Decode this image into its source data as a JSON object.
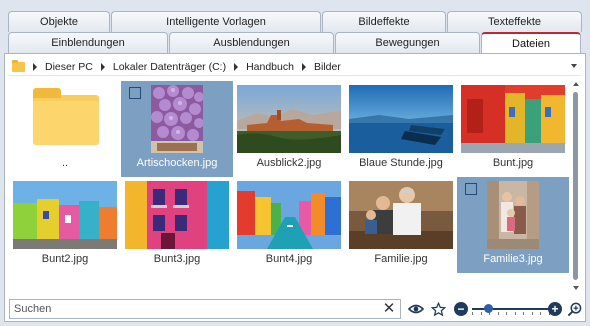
{
  "tabs_top": [
    {
      "label": "Objekte",
      "active": false
    },
    {
      "label": "Intelligente Vorlagen",
      "active": false
    },
    {
      "label": "Bildeffekte",
      "active": false
    },
    {
      "label": "Texteffekte",
      "active": false
    }
  ],
  "tabs_bottom": [
    {
      "label": "Einblendungen",
      "active": false
    },
    {
      "label": "Ausblendungen",
      "active": false
    },
    {
      "label": "Bewegungen",
      "active": false
    },
    {
      "label": "Dateien",
      "active": true
    }
  ],
  "breadcrumb": [
    "Dieser PC",
    "Lokaler Datenträger (C:)",
    "Handbuch",
    "Bilder"
  ],
  "files": [
    {
      "label": "..",
      "kind": "folder",
      "selected": false,
      "icon": "folder-icon"
    },
    {
      "label": "Artischocken.jpg",
      "kind": "image",
      "selected": true
    },
    {
      "label": "Ausblick2.jpg",
      "kind": "image",
      "selected": false
    },
    {
      "label": "Blaue Stunde.jpg",
      "kind": "image",
      "selected": false
    },
    {
      "label": "Bunt.jpg",
      "kind": "image",
      "selected": false
    },
    {
      "label": "Bunt2.jpg",
      "kind": "image",
      "selected": false
    },
    {
      "label": "Bunt3.jpg",
      "kind": "image",
      "selected": false
    },
    {
      "label": "Bunt4.jpg",
      "kind": "image",
      "selected": false
    },
    {
      "label": "Familie.jpg",
      "kind": "image",
      "selected": false
    },
    {
      "label": "Familie3.jpg",
      "kind": "image",
      "selected": true
    }
  ],
  "search": {
    "placeholder": "Suchen",
    "value": ""
  },
  "zoom": {
    "level": 0.2
  },
  "colors": {
    "accent": "#c4262e",
    "selection": "#7d9fc2",
    "slider": "#1f3a5c"
  },
  "icons": {
    "clear": "close-icon",
    "eye": "eye-icon",
    "favorite": "star-icon",
    "zoom_out": "minus-icon",
    "zoom_in": "plus-icon",
    "zoom_search": "zoom-magnifier-icon"
  }
}
